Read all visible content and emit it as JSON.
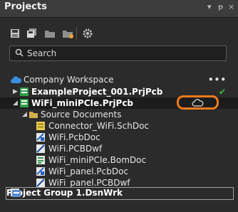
{
  "panel": {
    "title": "Projects"
  },
  "title_controls": [
    "▾",
    "ᵽ",
    "×"
  ],
  "toolbar": {
    "icons": [
      "save-icon",
      "save-all-icon",
      "folder-icon",
      "folder-open-icon",
      "gear-icon"
    ]
  },
  "search": {
    "placeholder": "Search",
    "value": ""
  },
  "tree": {
    "workspace": {
      "label": "Company Workspace",
      "more": "•••"
    },
    "projects": [
      {
        "label": "ExampleProject_001.PrjPcb",
        "status": "✔"
      },
      {
        "label": "WiFi_miniPCIe.PrjPcb",
        "cloud": "cloud-icon"
      }
    ],
    "folder": {
      "label": "Source Documents"
    },
    "documents": [
      {
        "label": "Connector_WiFi.SchDoc",
        "icon": "schematic-icon"
      },
      {
        "label": "WiFi.PcbDoc",
        "icon": "pcb-icon"
      },
      {
        "label": "WiFi.PCBDwf",
        "icon": "draftsman-icon"
      },
      {
        "label": "WiFi_miniPCIe.BomDoc",
        "icon": "bom-icon"
      },
      {
        "label": "WiFi_panel.PcbDoc",
        "icon": "pcb-icon"
      },
      {
        "label": "WiFi_panel.PCBDwf",
        "icon": "draftsman-icon"
      }
    ],
    "group": {
      "label": "Project Group 1.DsnWrk"
    }
  },
  "colors": {
    "accent_ring": "#f07b1e",
    "check": "#3cc23c",
    "background": "#2b2b2b"
  }
}
